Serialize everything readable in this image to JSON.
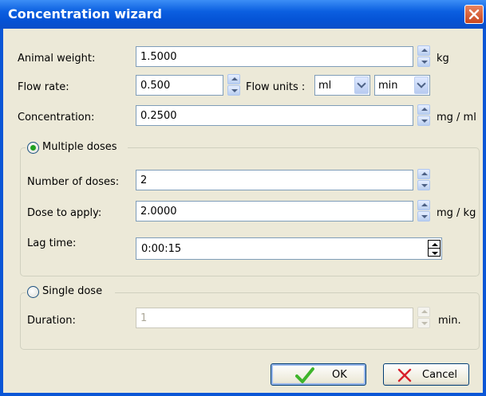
{
  "window": {
    "title": "Concentration wizard"
  },
  "animal_weight": {
    "label": "Animal weight:",
    "value": "1.5000",
    "unit": "kg"
  },
  "flow_rate": {
    "label": "Flow rate:",
    "value": "0.500",
    "units_label": "Flow units :",
    "volume_unit": "ml",
    "time_unit": "min"
  },
  "concentration": {
    "label": "Concentration:",
    "value": "0.2500",
    "unit": "mg / ml"
  },
  "multiple_doses": {
    "label": "Multiple doses",
    "selected": true,
    "number_label": "Number of doses:",
    "number_value": "2",
    "dose_label": "Dose to apply:",
    "dose_value": "2.0000",
    "dose_unit": "mg / kg",
    "lag_label": "Lag time:",
    "lag_value": "0:00:15"
  },
  "single_dose": {
    "label": "Single dose",
    "selected": false,
    "duration_label": "Duration:",
    "duration_value": "1",
    "duration_unit": "min."
  },
  "buttons": {
    "ok": "OK",
    "cancel": "Cancel"
  },
  "colors": {
    "titlebar": "#0553d6",
    "dialog_bg": "#ece9d8",
    "radio_selected": "#21a121"
  },
  "icons": {
    "close": "close-icon",
    "ok": "checkmark-icon",
    "cancel": "x-icon"
  }
}
